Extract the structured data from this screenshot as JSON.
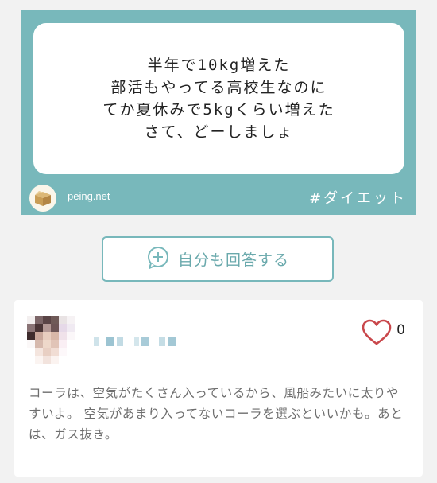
{
  "question": {
    "lines": [
      "半年で10kg増えた",
      "部活もやってる高校生なのに",
      "てか夏休みで5kgくらい増えた",
      "さて、どーしましょ"
    ],
    "site": "peing.net",
    "hashtag": "#ダイエット",
    "icons": {
      "site_logo": "cardboard-box-icon"
    }
  },
  "answer_button": {
    "label": "自分も回答する",
    "icon": "plus-speech-bubble-icon"
  },
  "answer": {
    "likes": "0",
    "text": "コーラは、空気がたくさん入っているから、風船みたいに太りやすいよ。 空気があまり入ってないコーラを選ぶといいかも。あとは、ガス抜き。",
    "icons": {
      "like": "heart-outline-icon",
      "avatar": "pixelated-avatar"
    }
  },
  "colors": {
    "teal": "#78b8bb",
    "teal_text": "#6aa9ac",
    "heart": "#c9474b"
  }
}
